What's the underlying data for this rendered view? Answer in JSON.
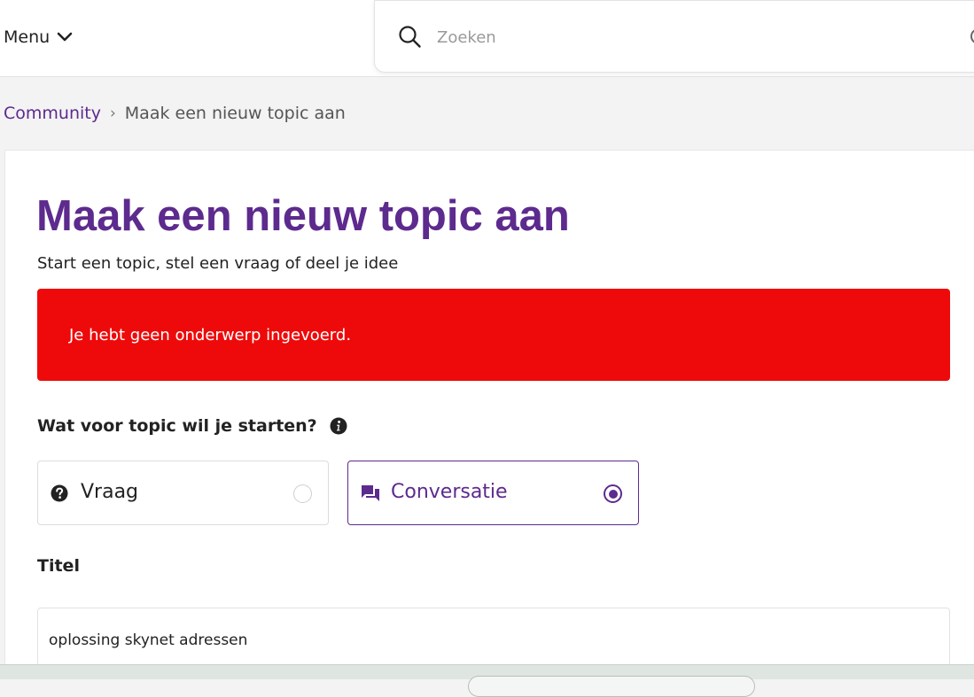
{
  "header": {
    "menu_label": "Menu",
    "search_placeholder": "Zoeken"
  },
  "breadcrumb": {
    "parent": "Community",
    "separator": "›",
    "current": "Maak een nieuw topic aan"
  },
  "main": {
    "title": "Maak een nieuw topic aan",
    "subtitle": "Start een topic, stel een vraag of deel je idee",
    "error": "Je hebt geen onderwerp ingevoerd.",
    "type_question": "Wat voor topic wil je starten?",
    "options": [
      {
        "label": "Vraag",
        "icon": "question-circle-icon",
        "selected": false
      },
      {
        "label": "Conversatie",
        "icon": "chat-bubbles-icon",
        "selected": true
      }
    ],
    "title_field_label": "Titel",
    "title_field_value": "oplossing skynet adressen"
  },
  "colors": {
    "brand_purple": "#5d2a8e",
    "error_red": "#ee0a0a"
  }
}
